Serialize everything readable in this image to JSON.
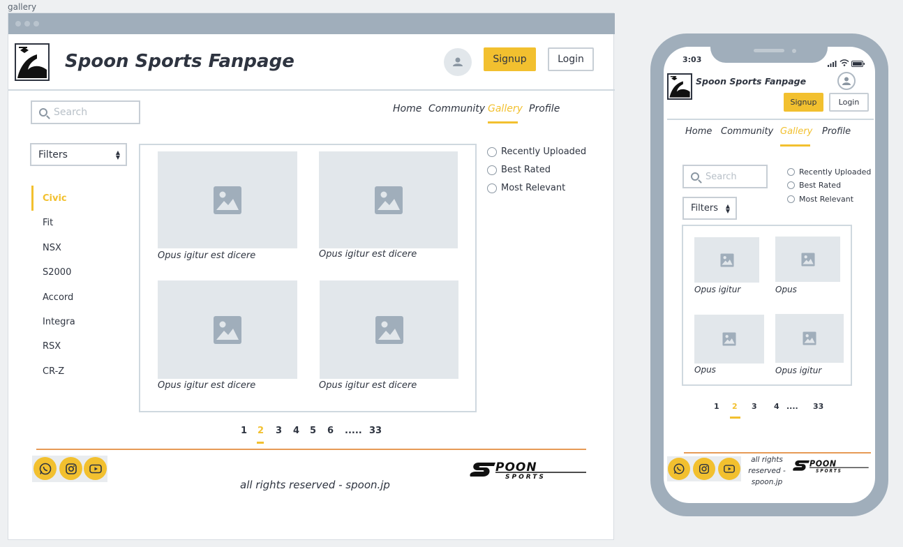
{
  "page_label": "gallery",
  "site": {
    "title": "Spoon Sports Fanpage",
    "signup_label": "Signup",
    "login_label": "Login"
  },
  "search": {
    "placeholder": "Search"
  },
  "nav": [
    {
      "label": "Home",
      "active": false
    },
    {
      "label": "Community",
      "active": false
    },
    {
      "label": "Gallery",
      "active": true
    },
    {
      "label": "Profile",
      "active": false
    }
  ],
  "filters": {
    "label": "Filters"
  },
  "categories": [
    {
      "label": "Civic",
      "active": true
    },
    {
      "label": "Fit",
      "active": false
    },
    {
      "label": "NSX",
      "active": false
    },
    {
      "label": "S2000",
      "active": false
    },
    {
      "label": "Accord",
      "active": false
    },
    {
      "label": "Integra",
      "active": false
    },
    {
      "label": "RSX",
      "active": false
    },
    {
      "label": "CR-Z",
      "active": false
    }
  ],
  "gallery": [
    {
      "caption": "Opus igitur est dicere"
    },
    {
      "caption": "Opus igitur est dicere"
    },
    {
      "caption": "Opus igitur est dicere"
    },
    {
      "caption": "Opus igitur est dicere"
    }
  ],
  "sort_options": [
    {
      "label": "Recently Uploaded"
    },
    {
      "label": "Best Rated"
    },
    {
      "label": "Most Relevant"
    }
  ],
  "pagination": {
    "pages": [
      "1",
      "2",
      "3",
      "4",
      "5",
      "6",
      ".....",
      "33"
    ],
    "current": "2"
  },
  "footer": {
    "rights": "all rights reserved - spoon.jp",
    "social_icons": [
      "whatsapp-icon",
      "instagram-icon",
      "youtube-icon"
    ],
    "brand_logo_text": "SPOON SPORTS"
  },
  "mobile": {
    "time": "3:03",
    "gallery_captions": [
      "Opus igitur",
      "Opus",
      "Opus",
      "Opus igitur"
    ],
    "pagination": [
      "1",
      "2",
      "3",
      "4",
      "....",
      "33"
    ],
    "current": "2",
    "rights": "all rights reserved - spoon.jp"
  },
  "colors": {
    "accent": "#f2c02f",
    "frame": "#a0aebb",
    "placeholder_fill": "#e2e7eb",
    "footer_line": "#e69a55",
    "text": "#2e3440"
  }
}
